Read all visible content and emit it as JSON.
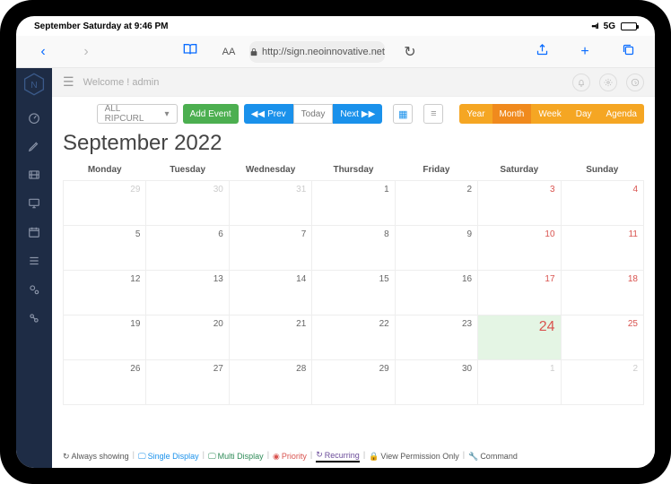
{
  "status": {
    "time": "September Saturday at 9:46 PM",
    "net": "5G"
  },
  "browser": {
    "url": "http://sign.neoinnovative.net",
    "aa": "AA"
  },
  "topbar": {
    "welcome": "Welcome ! admin"
  },
  "toolbar": {
    "filter_label": "ALL RIPCURL",
    "add_event": "Add Event",
    "prev": "Prev",
    "today": "Today",
    "next": "Next",
    "views": {
      "year": "Year",
      "month": "Month",
      "week": "Week",
      "day": "Day",
      "agenda": "Agenda"
    }
  },
  "calendar": {
    "title": "September 2022",
    "days": [
      "Monday",
      "Tuesday",
      "Wednesday",
      "Thursday",
      "Friday",
      "Saturday",
      "Sunday"
    ],
    "weeks": [
      [
        {
          "n": "29",
          "cls": "other"
        },
        {
          "n": "30",
          "cls": "other"
        },
        {
          "n": "31",
          "cls": "other"
        },
        {
          "n": "1"
        },
        {
          "n": "2"
        },
        {
          "n": "3",
          "cls": "weekend"
        },
        {
          "n": "4",
          "cls": "weekend"
        }
      ],
      [
        {
          "n": "5"
        },
        {
          "n": "6"
        },
        {
          "n": "7"
        },
        {
          "n": "8"
        },
        {
          "n": "9"
        },
        {
          "n": "10",
          "cls": "weekend"
        },
        {
          "n": "11",
          "cls": "weekend"
        }
      ],
      [
        {
          "n": "12"
        },
        {
          "n": "13"
        },
        {
          "n": "14"
        },
        {
          "n": "15"
        },
        {
          "n": "16"
        },
        {
          "n": "17",
          "cls": "weekend"
        },
        {
          "n": "18",
          "cls": "weekend"
        }
      ],
      [
        {
          "n": "19"
        },
        {
          "n": "20"
        },
        {
          "n": "21"
        },
        {
          "n": "22"
        },
        {
          "n": "23"
        },
        {
          "n": "24",
          "cls": "today"
        },
        {
          "n": "25",
          "cls": "weekend"
        }
      ],
      [
        {
          "n": "26"
        },
        {
          "n": "27"
        },
        {
          "n": "28"
        },
        {
          "n": "29"
        },
        {
          "n": "30"
        },
        {
          "n": "1",
          "cls": "other"
        },
        {
          "n": "2",
          "cls": "other"
        }
      ]
    ]
  },
  "legend": {
    "always": "Always showing",
    "single": "Single Display",
    "multi": "Multi Display",
    "priority": "Priority",
    "recurring": "Recurring",
    "view_perm": "View Permission Only",
    "command": "Command"
  },
  "colors": {
    "accent_blue": "#1a91eb",
    "accent_green": "#4caf50",
    "accent_orange": "#f5a623",
    "weekend_red": "#d9534f",
    "sidebar_bg": "#1e2c45"
  }
}
